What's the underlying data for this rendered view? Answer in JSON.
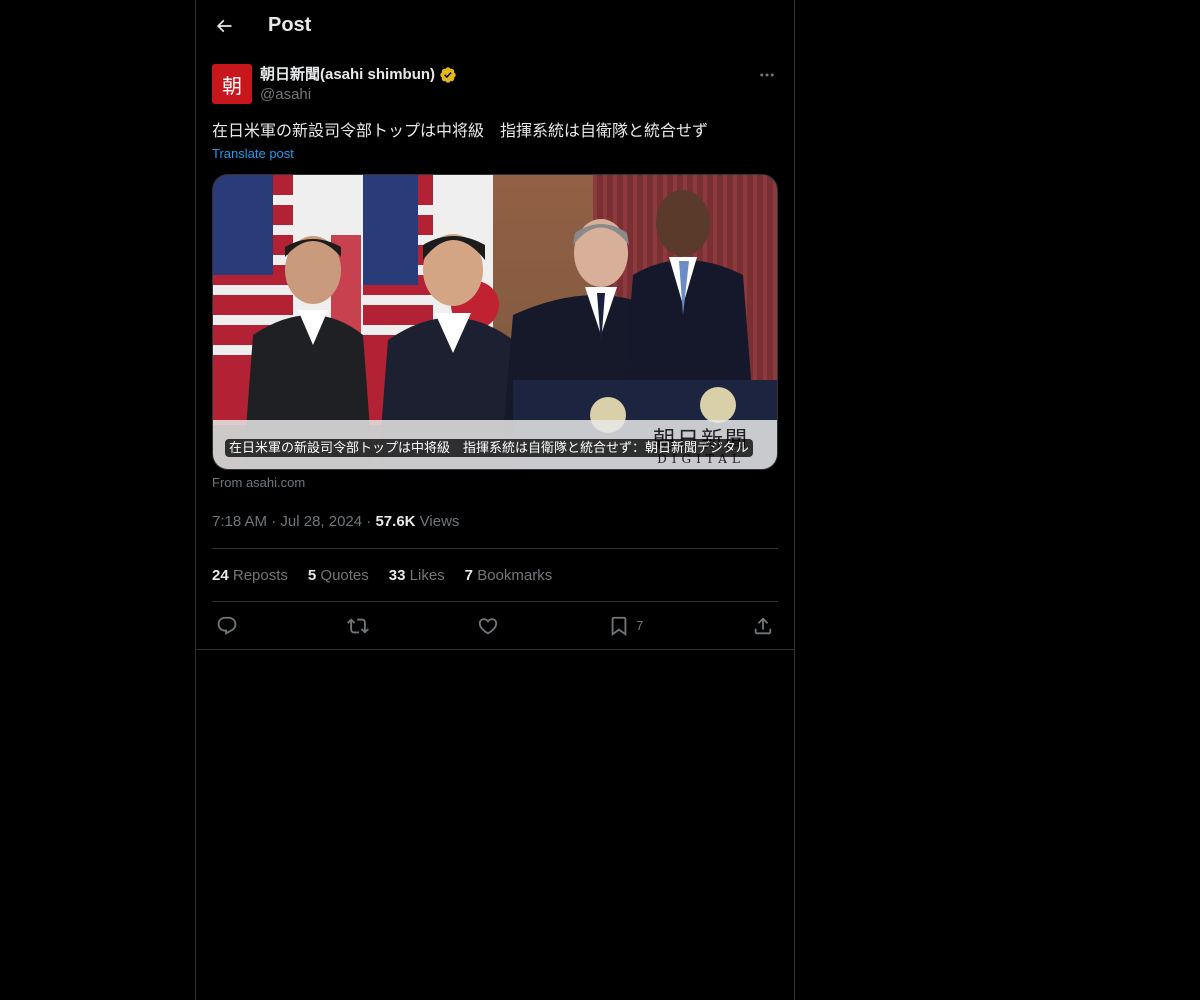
{
  "header": {
    "title": "Post"
  },
  "post": {
    "avatar_char": "朝",
    "display_name": "朝日新聞(asahi shimbun)",
    "handle": "@asahi",
    "text": "在日米軍の新設司令部トップは中将級　指揮系統は自衛隊と統合せず",
    "translate_label": "Translate post",
    "media_caption": "在日米軍の新設司令部トップは中将級　指揮系統は自衛隊と統合せず：朝日新聞デジタル",
    "source": "From asahi.com",
    "time": "7:18 AM",
    "date": "Jul 28, 2024",
    "views_count": "57.6K",
    "views_label": "Views"
  },
  "stats": {
    "reposts_count": "24",
    "reposts_label": "Reposts",
    "quotes_count": "5",
    "quotes_label": "Quotes",
    "likes_count": "33",
    "likes_label": "Likes",
    "bookmarks_count": "7",
    "bookmarks_label": "Bookmarks"
  },
  "actions": {
    "bookmark_count": "7"
  },
  "icons": {
    "back": "arrow-left-icon",
    "verified": "verified-badge-icon",
    "more": "more-icon",
    "reply": "reply-icon",
    "repost": "repost-icon",
    "like": "heart-icon",
    "bookmark": "bookmark-icon",
    "share": "share-icon"
  },
  "colors": {
    "background": "#000000",
    "accent": "#1d9bf0",
    "verified_gold": "#e2b719",
    "avatar_red": "#c8161d",
    "muted": "#71767b"
  }
}
